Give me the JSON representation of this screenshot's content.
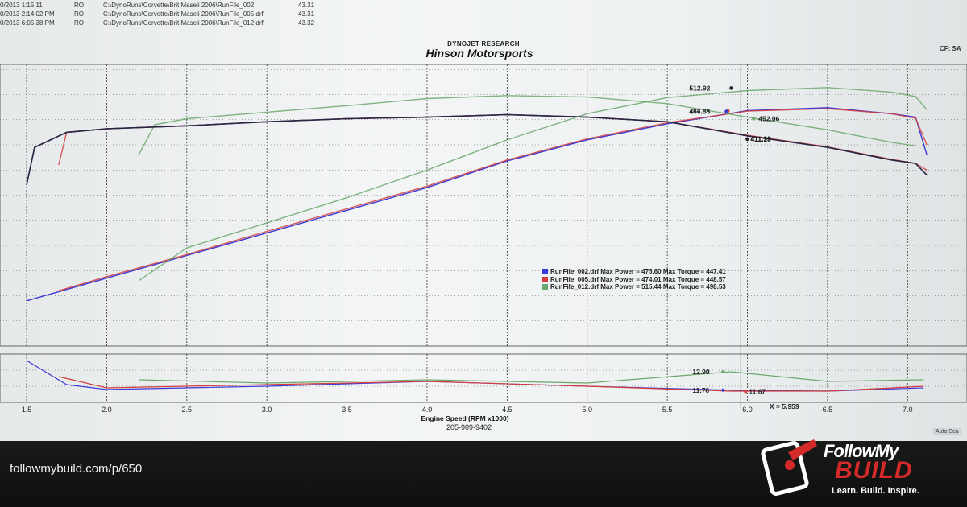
{
  "file_list": [
    {
      "date": "0/2013 1:15:11",
      "flag": "RO",
      "path": "C:\\DynoRuns\\Corvette\\Brit Maseli 2006\\RunFile_002",
      "time": "43.31"
    },
    {
      "date": "0/2013 2:14:02 PM",
      "flag": "RO",
      "path": "C:\\DynoRuns\\Corvette\\Brit Maseli 2006\\RunFile_005.drf",
      "time": "43.31"
    },
    {
      "date": "0/2013 6:05:38 PM",
      "flag": "RO",
      "path": "C:\\DynoRuns\\Corvette\\Brit Maseli 2006\\RunFile_012.drf",
      "time": "43.32"
    }
  ],
  "header": {
    "report_title": "DYNOJET RESEARCH",
    "shop_name": "Hinson Motorsports",
    "cf_label": "CF: SA"
  },
  "chart_data": {
    "type": "line",
    "title": "Hinson Motorsports",
    "xlabel": "Engine Speed (RPM x1000)",
    "subtitle": "205-909-9402",
    "x_ticks": [
      "1.5",
      "2.0",
      "2.5",
      "3.0",
      "3.5",
      "4.0",
      "4.5",
      "5.0",
      "5.5",
      "6.0",
      "6.5",
      "7.0"
    ],
    "xlim": [
      1.5,
      7.25
    ],
    "grid": true,
    "legend_position": "center-right",
    "cursor_x": "X = 5.959",
    "series": [
      {
        "name": "RunFile_002.drf",
        "color": "#3b3bd8",
        "max_power": "475.60",
        "max_torque": "447.41",
        "power": [
          [
            1.5,
            90
          ],
          [
            2.0,
            135
          ],
          [
            2.5,
            180
          ],
          [
            3.0,
            225
          ],
          [
            3.5,
            270
          ],
          [
            4.0,
            315
          ],
          [
            4.5,
            368
          ],
          [
            5.0,
            410
          ],
          [
            5.5,
            442
          ],
          [
            6.0,
            468
          ],
          [
            6.5,
            474
          ],
          [
            6.9,
            462
          ],
          [
            7.05,
            455
          ],
          [
            7.12,
            380
          ]
        ],
        "torque": [
          [
            1.5,
            320
          ],
          [
            1.55,
            395
          ],
          [
            1.75,
            425
          ],
          [
            2.0,
            432
          ],
          [
            2.5,
            438
          ],
          [
            3.0,
            446
          ],
          [
            3.5,
            452
          ],
          [
            4.0,
            455
          ],
          [
            4.5,
            460
          ],
          [
            5.0,
            455
          ],
          [
            5.5,
            446
          ],
          [
            6.0,
            418
          ],
          [
            6.5,
            395
          ],
          [
            6.9,
            370
          ],
          [
            7.05,
            363
          ],
          [
            7.12,
            340
          ]
        ]
      },
      {
        "name": "RunFile_005.drf",
        "color": "#d23c3c",
        "max_power": "474.01",
        "max_torque": "448.57",
        "power": [
          [
            1.7,
            110
          ],
          [
            2.0,
            138
          ],
          [
            2.5,
            182
          ],
          [
            3.0,
            228
          ],
          [
            3.5,
            273
          ],
          [
            4.0,
            318
          ],
          [
            4.5,
            370
          ],
          [
            5.0,
            412
          ],
          [
            5.5,
            444
          ],
          [
            6.0,
            467
          ],
          [
            6.5,
            472
          ],
          [
            6.9,
            462
          ],
          [
            7.05,
            453
          ],
          [
            7.12,
            400
          ]
        ],
        "torque": [
          [
            1.7,
            360
          ],
          [
            1.75,
            425
          ],
          [
            2.0,
            432
          ],
          [
            2.5,
            438
          ],
          [
            3.0,
            446
          ],
          [
            3.5,
            452
          ],
          [
            4.0,
            455
          ],
          [
            4.5,
            460
          ],
          [
            5.0,
            455
          ],
          [
            5.5,
            446
          ],
          [
            6.0,
            419
          ],
          [
            6.5,
            396
          ],
          [
            6.9,
            371
          ],
          [
            7.05,
            363
          ],
          [
            7.12,
            350
          ]
        ]
      },
      {
        "name": "RunFile_012.drf",
        "color": "#6ba86b",
        "max_power": "515.44",
        "max_torque": "498.53",
        "power": [
          [
            2.2,
            130
          ],
          [
            2.5,
            195
          ],
          [
            3.0,
            245
          ],
          [
            3.5,
            295
          ],
          [
            4.0,
            350
          ],
          [
            4.5,
            410
          ],
          [
            5.0,
            462
          ],
          [
            5.5,
            494
          ],
          [
            6.0,
            508
          ],
          [
            6.5,
            514
          ],
          [
            6.9,
            505
          ],
          [
            7.05,
            496
          ],
          [
            7.12,
            470
          ]
        ],
        "torque": [
          [
            2.2,
            380
          ],
          [
            2.3,
            440
          ],
          [
            2.5,
            452
          ],
          [
            3.0,
            465
          ],
          [
            3.5,
            478
          ],
          [
            4.0,
            492
          ],
          [
            4.5,
            498
          ],
          [
            5.0,
            495
          ],
          [
            5.5,
            482
          ],
          [
            6.0,
            455
          ],
          [
            6.5,
            430
          ],
          [
            6.9,
            405
          ],
          [
            7.05,
            398
          ]
        ]
      }
    ],
    "cursor_values": [
      {
        "label": "512.92",
        "color": "#222222",
        "y_hp": 512.92
      },
      {
        "label": "467.37",
        "color": "#d23c3c",
        "y_hp": 467.37
      },
      {
        "label": "466.55",
        "color": "#3b3bd8",
        "y_hp": 466.55
      },
      {
        "label": "452.06",
        "color": "#6ba86b",
        "y_hp": 452.06
      },
      {
        "label": "411.93",
        "color": "#d23c3c",
        "y_hp": 411.93
      },
      {
        "label": "411.19",
        "color": "#222222",
        "y_hp": 411.19
      }
    ],
    "afr": {
      "cursor_values": [
        {
          "label": "12.90",
          "color": "#6ba86b",
          "y": 12.9
        },
        {
          "label": "11.76",
          "color": "#3b3bd8",
          "y": 11.76
        },
        {
          "label": "11.67",
          "color": "#d23c3c",
          "y": 11.67
        }
      ],
      "series": [
        {
          "name": "RunFile_002.drf",
          "color": "#3b3bd8",
          "points": [
            [
              1.5,
              13.6
            ],
            [
              1.75,
              12.1
            ],
            [
              2.0,
              11.8
            ],
            [
              3.0,
              12.0
            ],
            [
              4.0,
              12.3
            ],
            [
              5.0,
              12.0
            ],
            [
              5.9,
              11.76
            ],
            [
              6.5,
              11.7
            ],
            [
              7.1,
              11.9
            ]
          ]
        },
        {
          "name": "RunFile_005.drf",
          "color": "#d23c3c",
          "points": [
            [
              1.7,
              12.6
            ],
            [
              2.0,
              11.9
            ],
            [
              3.0,
              12.1
            ],
            [
              4.0,
              12.3
            ],
            [
              5.0,
              12.0
            ],
            [
              5.9,
              11.7
            ],
            [
              6.5,
              11.7
            ],
            [
              7.1,
              12.0
            ]
          ]
        },
        {
          "name": "RunFile_012.drf",
          "color": "#6ba86b",
          "points": [
            [
              2.2,
              12.4
            ],
            [
              3.0,
              12.2
            ],
            [
              4.0,
              12.4
            ],
            [
              5.0,
              12.2
            ],
            [
              5.9,
              12.9
            ],
            [
              6.5,
              12.3
            ],
            [
              7.1,
              12.4
            ]
          ]
        }
      ]
    }
  },
  "footer": {
    "auto_scale": "Auto Sca",
    "url": "followmybuild.com/p/650",
    "logo_follow": "FollowMy",
    "logo_build": "BUILD",
    "logo_tagline": "Learn.   Build.   Inspire."
  }
}
